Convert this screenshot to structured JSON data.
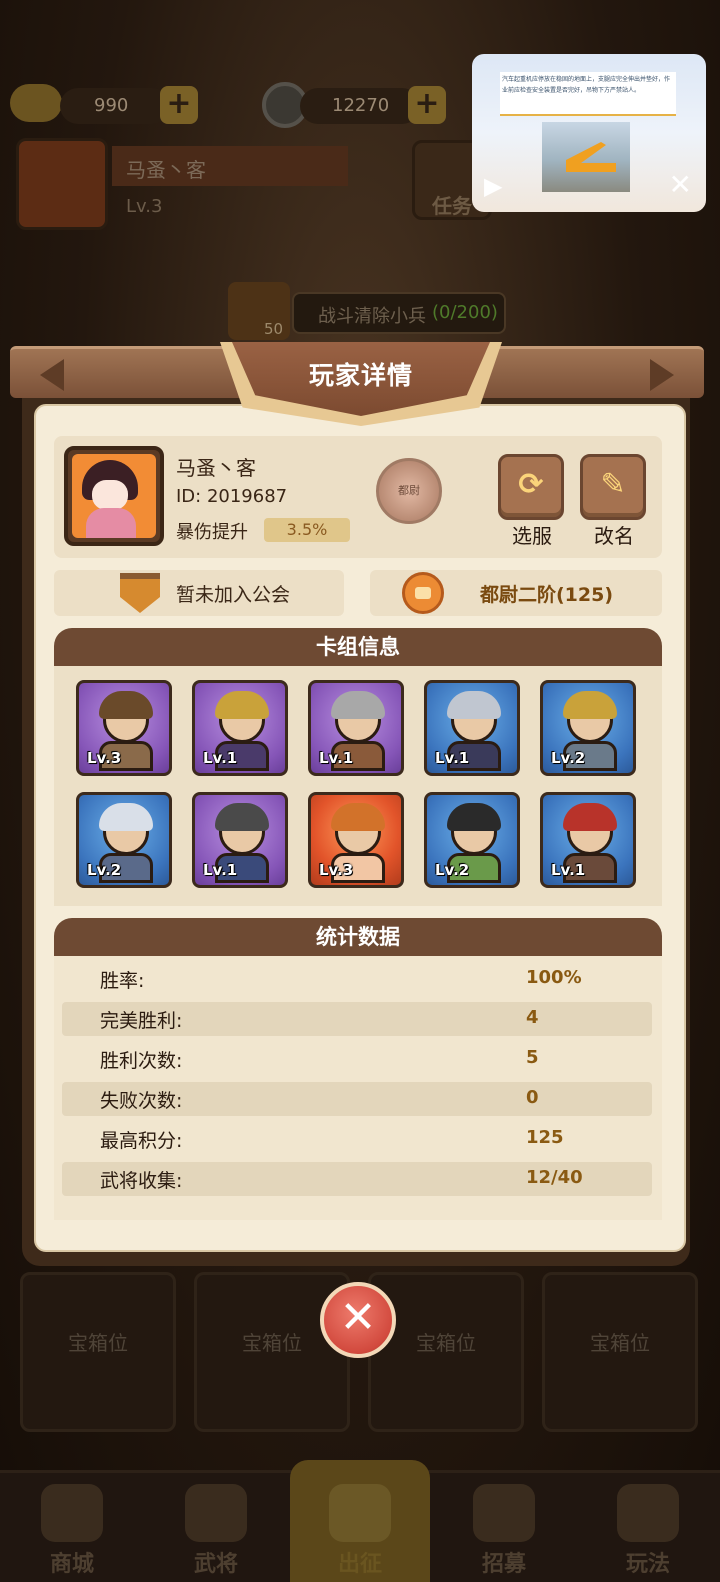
{
  "hud": {
    "gold": "990",
    "coins": "12270",
    "player_name": "马蚤丶客",
    "player_level": "Lv.3",
    "task_label": "任务",
    "quest_text": "战斗清除小兵",
    "quest_progress": "(0/200)",
    "quest_reward": "50"
  },
  "panel": {
    "title": "玩家详情",
    "name": "马蚤丶客",
    "id_label": "ID: 2019687",
    "crit_label": "暴伤提升",
    "crit_value": "3.5%",
    "seal_text": "都尉",
    "server_button": "选服",
    "rename_button": "改名",
    "guild": "暂未加入公会",
    "rank": "都尉二阶(125)",
    "deck_title": "卡组信息",
    "stats_title": "统计数据"
  },
  "deck": [
    {
      "level": "Lv.3",
      "rarity": "purple"
    },
    {
      "level": "Lv.1",
      "rarity": "purple"
    },
    {
      "level": "Lv.1",
      "rarity": "purple"
    },
    {
      "level": "Lv.1",
      "rarity": "blue"
    },
    {
      "level": "Lv.2",
      "rarity": "blue"
    },
    {
      "level": "Lv.2",
      "rarity": "blue"
    },
    {
      "level": "Lv.1",
      "rarity": "purple"
    },
    {
      "level": "Lv.3",
      "rarity": "red"
    },
    {
      "level": "Lv.2",
      "rarity": "blue"
    },
    {
      "level": "Lv.1",
      "rarity": "blue"
    }
  ],
  "stats": [
    {
      "label": "胜率:",
      "value": "100%"
    },
    {
      "label": "完美胜利:",
      "value": "4"
    },
    {
      "label": "胜利次数:",
      "value": "5"
    },
    {
      "label": "失败次数:",
      "value": "0"
    },
    {
      "label": "最高积分:",
      "value": "125"
    },
    {
      "label": "武将收集:",
      "value": "12/40"
    }
  ],
  "chests": [
    "宝箱位",
    "宝箱位",
    "宝箱位",
    "宝箱位"
  ],
  "nav": [
    "商城",
    "武将",
    "出征",
    "招募",
    "玩法"
  ],
  "ad": {
    "caption": "汽车起重机应停放在稳固的地面上，支腿应完全伸出并垫好，作业前应检查安全装置是否完好，吊物下方严禁站人。"
  },
  "colors": {
    "panel_bg": "#f5ecd8",
    "header_brown": "#6e4a33",
    "stat_value": "#8a5a12",
    "close_red": "#d24a3e"
  }
}
